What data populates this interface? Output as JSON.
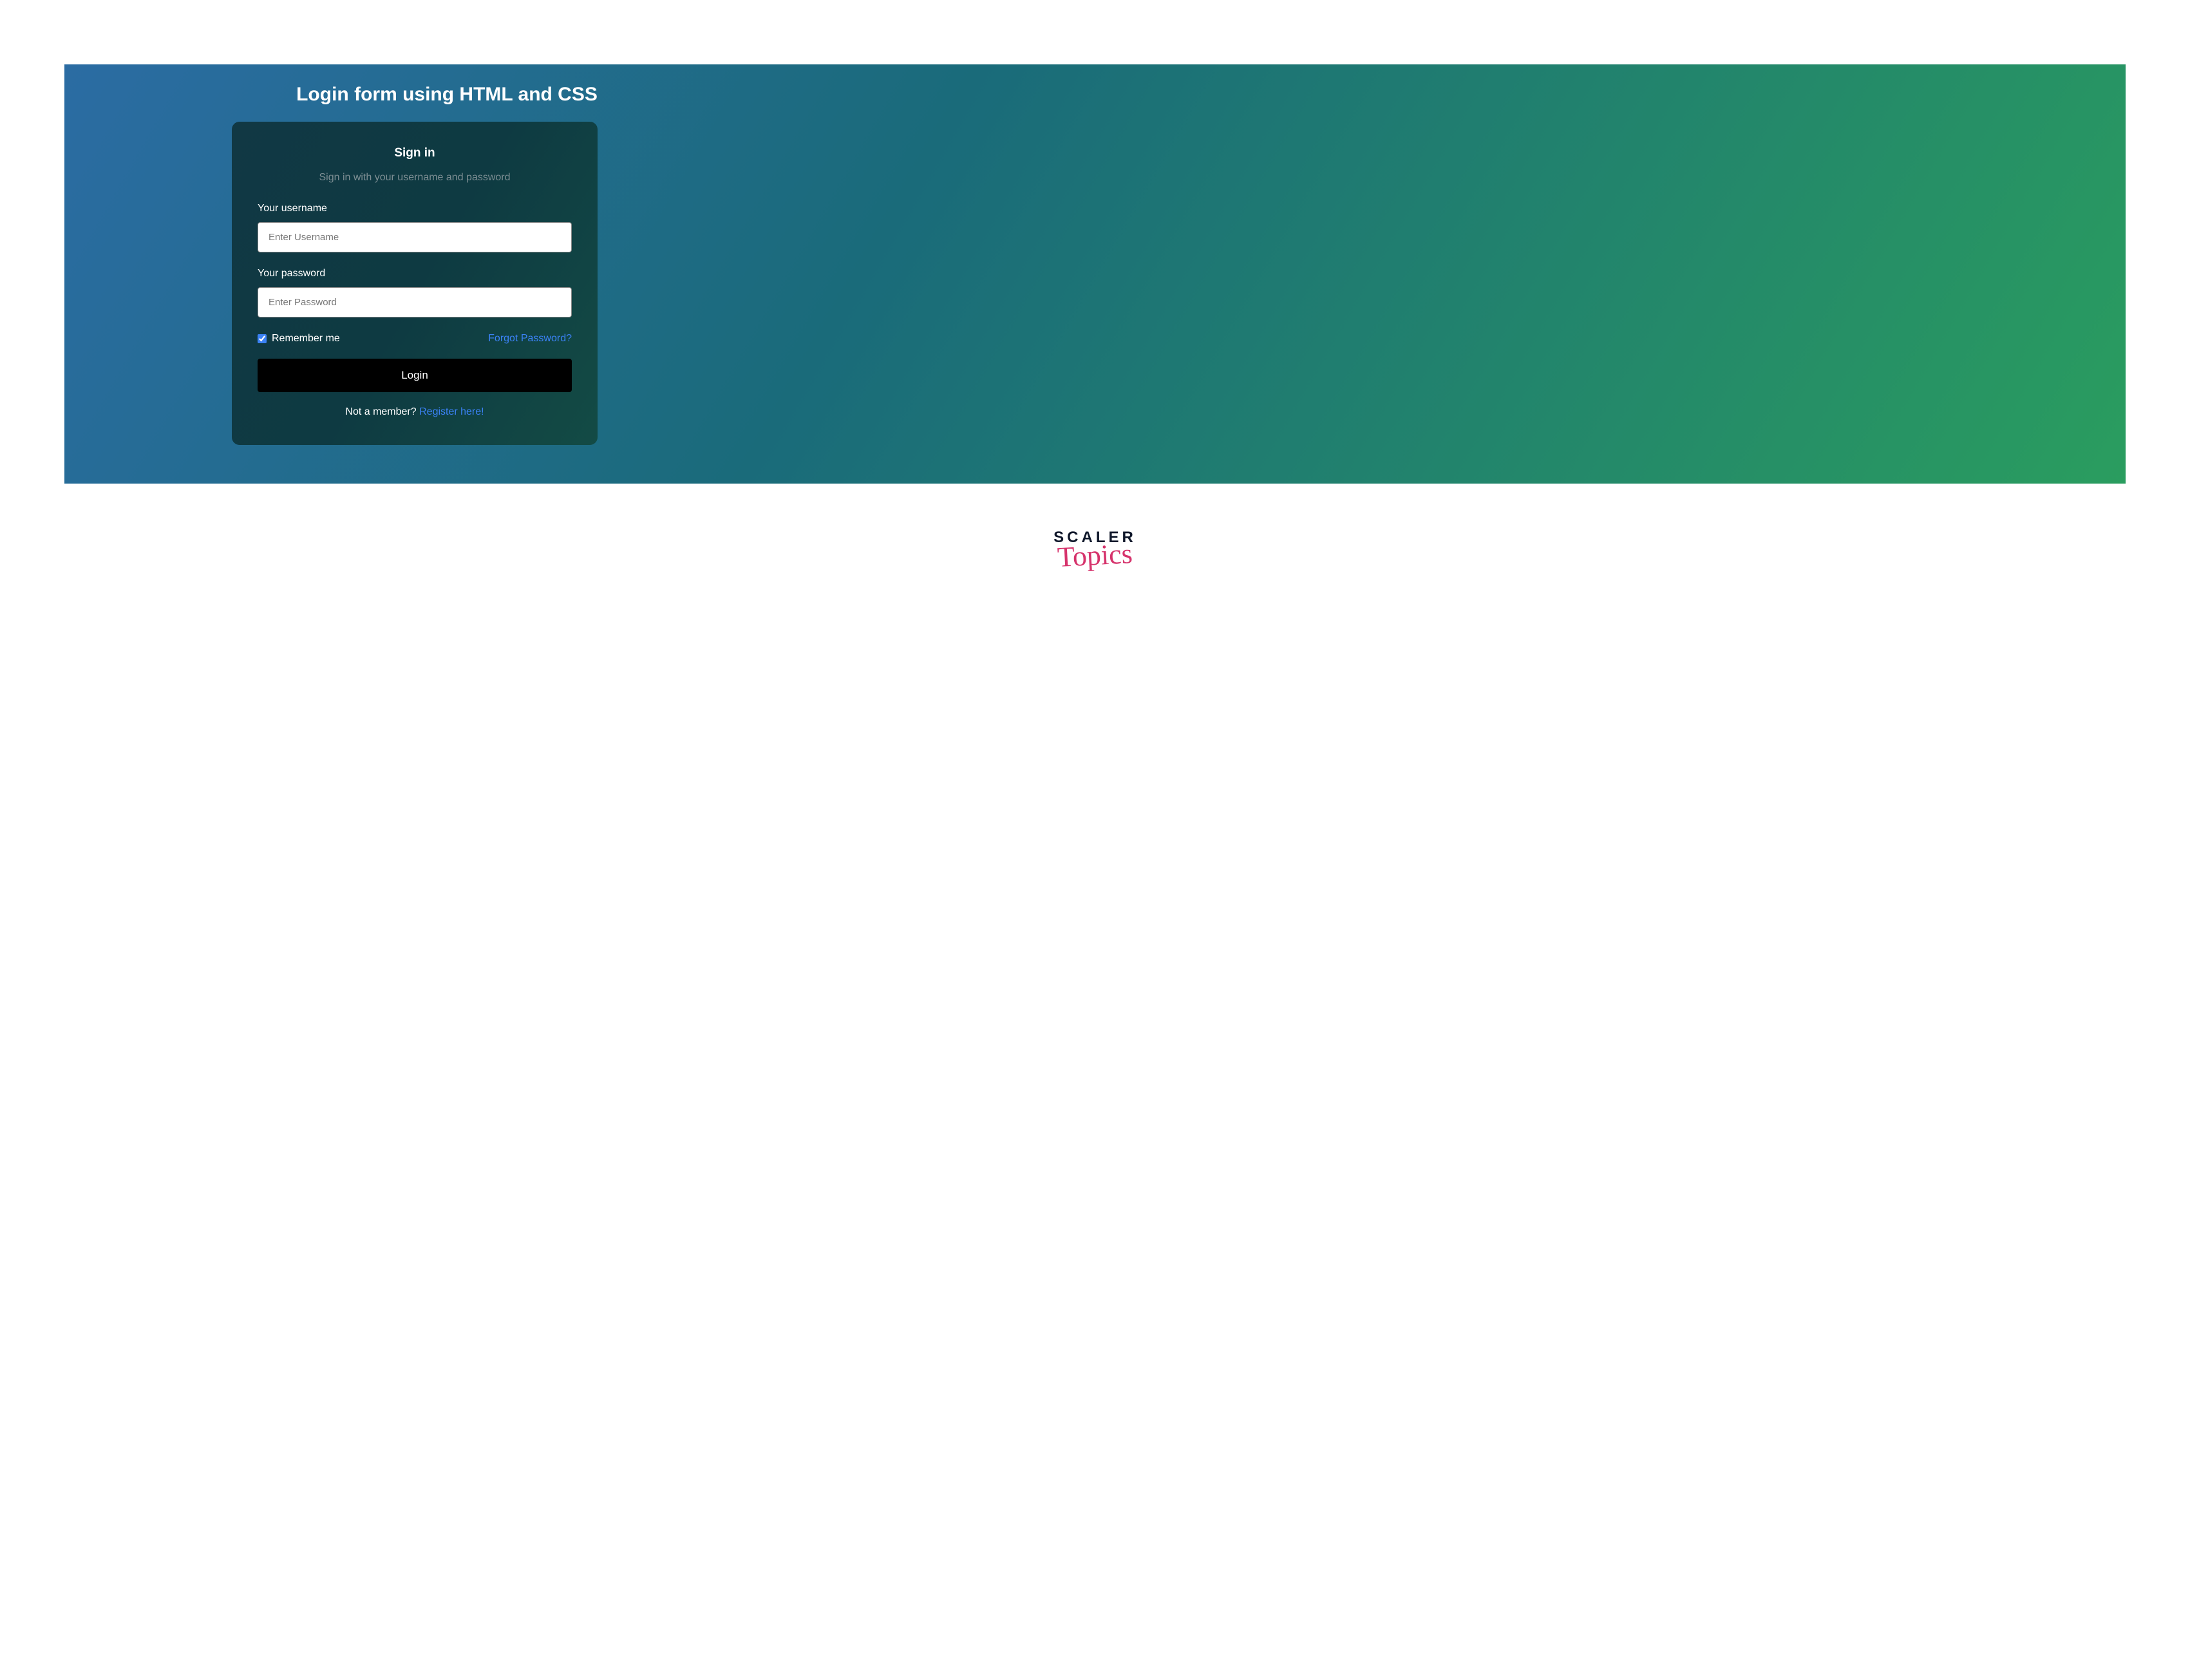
{
  "page": {
    "title": "Login form using HTML and CSS"
  },
  "card": {
    "heading": "Sign in",
    "subtitle": "Sign in with your username and password",
    "username_label": "Your username",
    "username_placeholder": "Enter Username",
    "username_value": "",
    "password_label": "Your password",
    "password_placeholder": "Enter Password",
    "password_value": "",
    "remember_label": "Remember me",
    "remember_checked": true,
    "forgot_link": "Forgot Password?",
    "login_button": "Login",
    "register_text": "Not a member? ",
    "register_link": "Register here!"
  },
  "footer": {
    "logo_line1": "SCALER",
    "logo_line2": "Topics"
  }
}
